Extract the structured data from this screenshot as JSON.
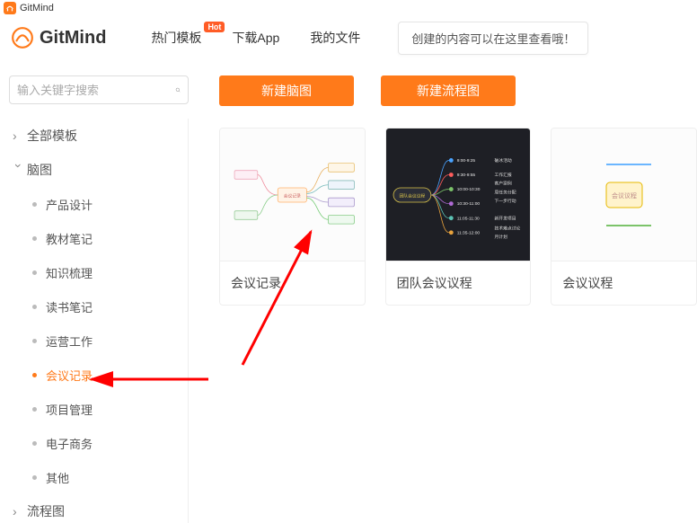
{
  "window": {
    "title": "GitMind"
  },
  "brand": {
    "name": "GitMind"
  },
  "nav": {
    "items": [
      {
        "label": "热门模板",
        "badge": "Hot"
      },
      {
        "label": "下载App"
      },
      {
        "label": "我的文件"
      }
    ],
    "tip": "创建的内容可以在这里查看哦！"
  },
  "search": {
    "placeholder": "输入关键字搜索"
  },
  "sidebar": {
    "all_templates": "全部模板",
    "mindmap": {
      "label": "脑图",
      "items": [
        {
          "label": "产品设计"
        },
        {
          "label": "教材笔记"
        },
        {
          "label": "知识梳理"
        },
        {
          "label": "读书笔记"
        },
        {
          "label": "运营工作"
        },
        {
          "label": "会议记录",
          "active": true
        },
        {
          "label": "项目管理"
        },
        {
          "label": "电子商务"
        },
        {
          "label": "其他"
        }
      ]
    },
    "flowchart": {
      "label": "流程图"
    }
  },
  "buttons": {
    "new_mindmap": "新建脑图",
    "new_flowchart": "新建流程图"
  },
  "templates": [
    {
      "title": "会议记录",
      "thumb": "light-mindmap"
    },
    {
      "title": "团队会议议程",
      "thumb": "dark-timeline"
    },
    {
      "title": "会议议程",
      "thumb": "light-partial"
    }
  ],
  "colors": {
    "accent": "#ff7a1a"
  }
}
